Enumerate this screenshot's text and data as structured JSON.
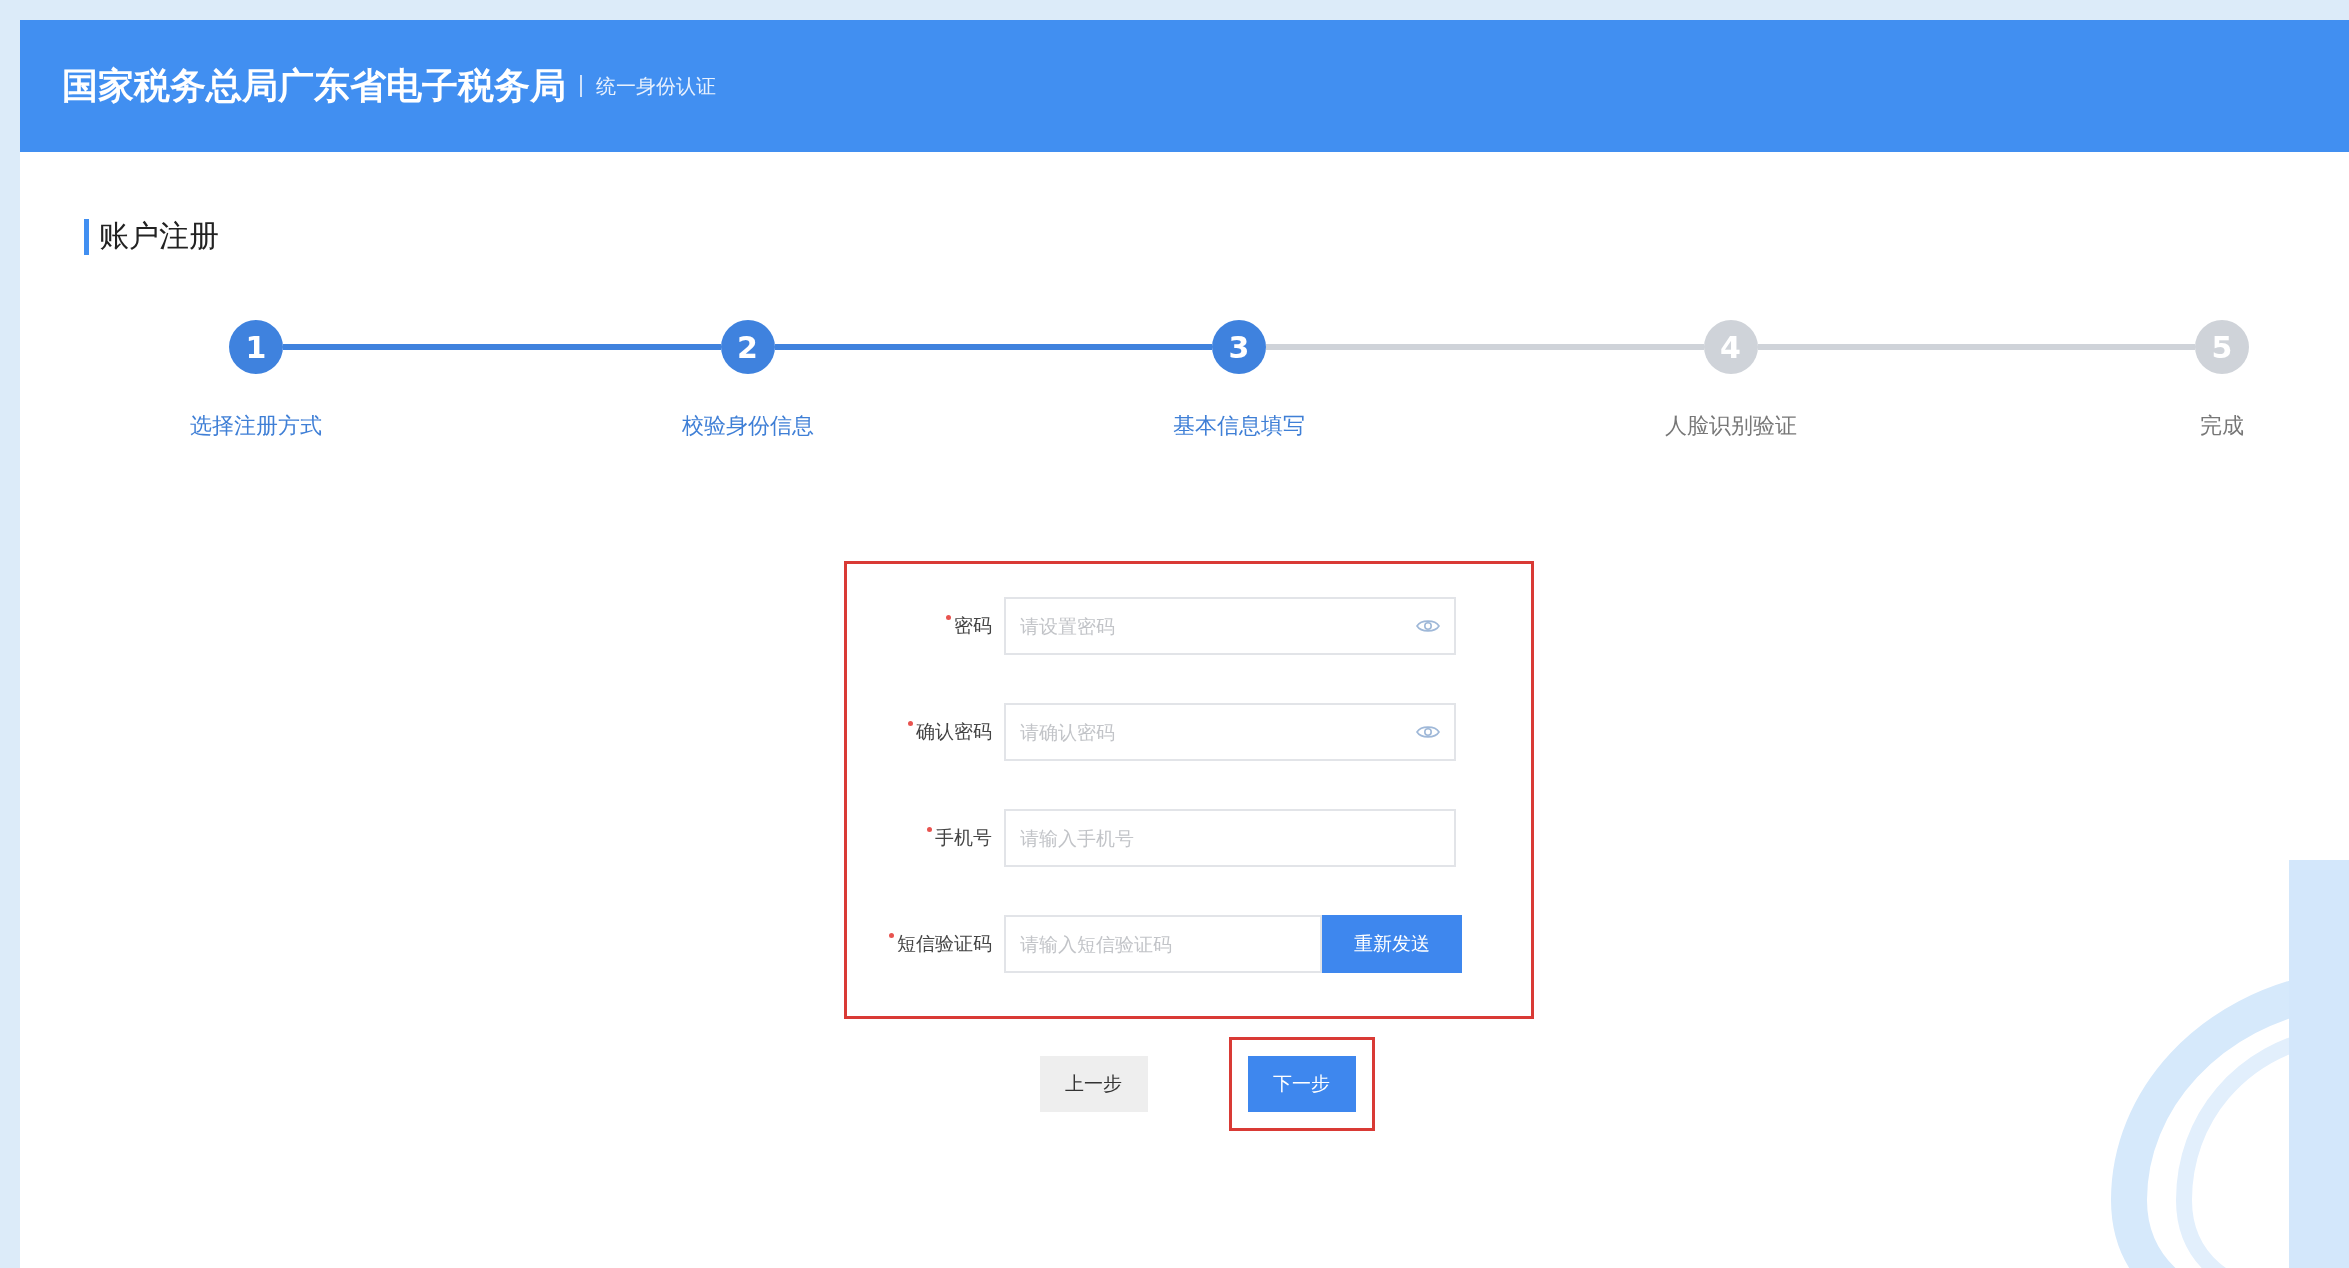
{
  "header": {
    "title": "国家税务总局广东省电子税务局",
    "subtitle": "统一身份认证"
  },
  "section_title": "账户注册",
  "steps": [
    {
      "number": "1",
      "label": "选择注册方式",
      "reached": true
    },
    {
      "number": "2",
      "label": "校验身份信息",
      "reached": true
    },
    {
      "number": "3",
      "label": "基本信息填写",
      "reached": true
    },
    {
      "number": "4",
      "label": "人脸识别验证",
      "reached": false
    },
    {
      "number": "5",
      "label": "完成",
      "reached": false
    }
  ],
  "form": {
    "highlighted": true,
    "fields": [
      {
        "kind": "password",
        "label": "密码",
        "required": true,
        "placeholder": "请设置密码"
      },
      {
        "kind": "password",
        "label": "确认密码",
        "required": true,
        "placeholder": "请确认密码"
      },
      {
        "kind": "text",
        "label": "手机号",
        "required": true,
        "placeholder": "请输入手机号"
      },
      {
        "kind": "sms",
        "label": "短信验证码",
        "required": true,
        "placeholder": "请输入短信验证码",
        "button": "重新发送"
      }
    ]
  },
  "actions": [
    {
      "label": "上一步",
      "primary": false,
      "highlighted": false
    },
    {
      "label": "下一步",
      "primary": true,
      "highlighted": true
    }
  ]
}
